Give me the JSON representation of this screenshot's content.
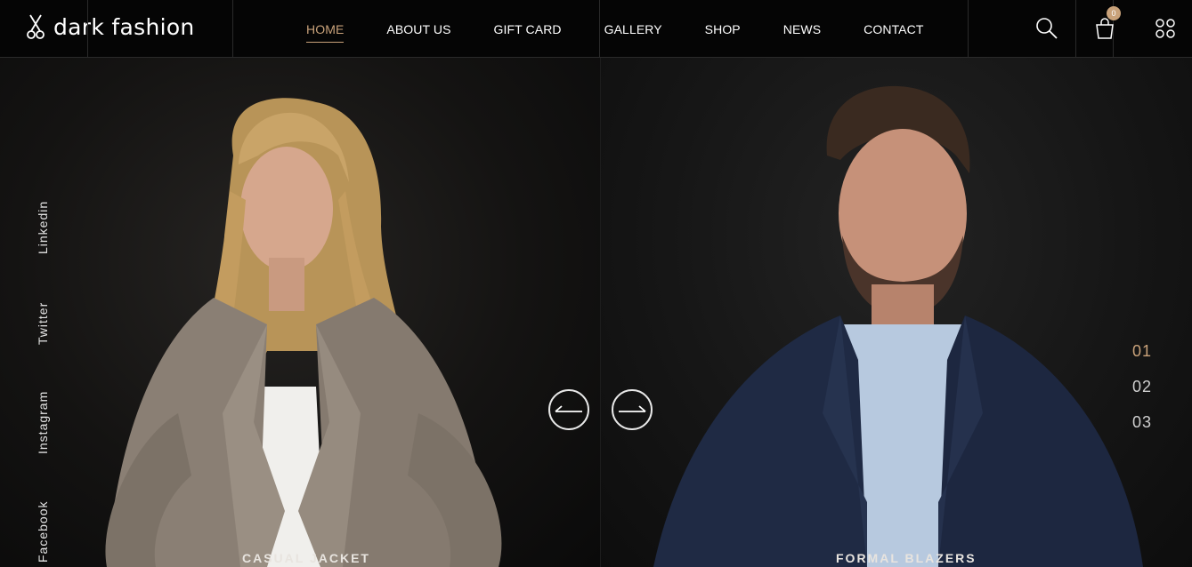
{
  "brand": {
    "name": "dark fashion",
    "icon": "scissors-icon"
  },
  "nav": {
    "items": [
      {
        "label": "HOME",
        "active": true
      },
      {
        "label": "ABOUT US",
        "active": false
      },
      {
        "label": "GIFT CARD",
        "active": false
      },
      {
        "label": "GALLERY",
        "active": false
      },
      {
        "label": "SHOP",
        "active": false
      },
      {
        "label": "NEWS",
        "active": false
      },
      {
        "label": "CONTACT",
        "active": false
      }
    ]
  },
  "header_actions": {
    "search_icon": "search-icon",
    "cart_icon": "shopping-bag-icon",
    "cart_count": "0",
    "menu_icon": "grid-menu-icon"
  },
  "social": [
    "Linkedin",
    "Twitter",
    "Instagram",
    "Facebook"
  ],
  "slides": {
    "left_caption": "CASUAL JACKET",
    "right_caption": "FORMAL BLAZERS",
    "counters": [
      "01",
      "02",
      "03"
    ],
    "active_index": 0
  },
  "colors": {
    "accent": "#c9a27a",
    "background": "#050505"
  }
}
